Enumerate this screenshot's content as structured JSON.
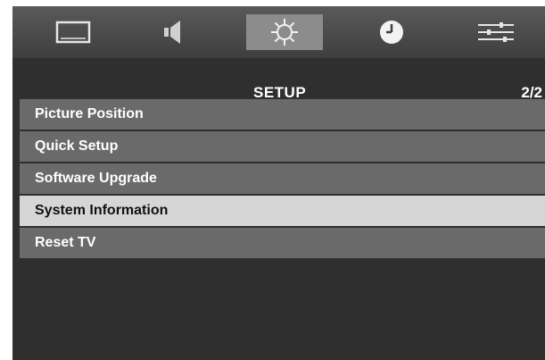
{
  "tabs": [
    {
      "icon": "picture-icon",
      "active": false
    },
    {
      "icon": "sound-icon",
      "active": false
    },
    {
      "icon": "setup-gear-icon",
      "active": true
    },
    {
      "icon": "clock-icon",
      "active": false
    },
    {
      "icon": "options-sliders-icon",
      "active": false
    }
  ],
  "menu": {
    "title": "SETUP",
    "page": "2/2",
    "items": [
      {
        "label": "Picture Position",
        "selected": false
      },
      {
        "label": "Quick Setup",
        "selected": false
      },
      {
        "label": "Software Upgrade",
        "selected": false
      },
      {
        "label": "System Information",
        "selected": true
      },
      {
        "label": "Reset TV",
        "selected": false
      }
    ]
  },
  "colors": {
    "background": "#2f2f2f",
    "item": "#6a6a6a",
    "selected_item": "#d6d6d6",
    "active_tab": "#8c8c8c"
  }
}
